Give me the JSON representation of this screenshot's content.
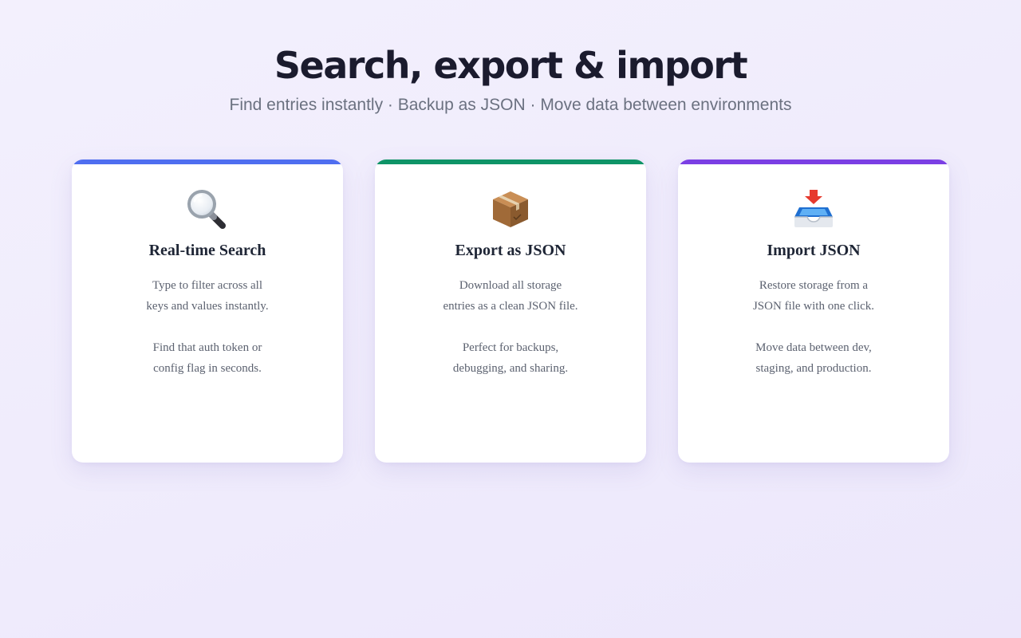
{
  "header": {
    "title": "Search, export & import",
    "subtitle": "Find entries instantly · Backup as JSON · Move data between environments"
  },
  "colors": {
    "search_accent": "#4f6ef0",
    "export_accent": "#0f9467",
    "import_accent": "#7b3fe4"
  },
  "cards": [
    {
      "icon": "magnifying-glass-icon",
      "title": "Real-time Search",
      "p1_l1": "Type to filter across all",
      "p1_l2": "keys and values instantly.",
      "p2_l1": "Find that auth token or",
      "p2_l2": "config flag in seconds."
    },
    {
      "icon": "package-box-icon",
      "title": "Export as JSON",
      "p1_l1": "Download all storage",
      "p1_l2": "entries as a clean JSON file.",
      "p2_l1": "Perfect for backups,",
      "p2_l2": "debugging, and sharing."
    },
    {
      "icon": "inbox-tray-icon",
      "title": "Import JSON",
      "p1_l1": "Restore storage from a",
      "p1_l2": "JSON file with one click.",
      "p2_l1": "Move data between dev,",
      "p2_l2": "staging, and production."
    }
  ]
}
